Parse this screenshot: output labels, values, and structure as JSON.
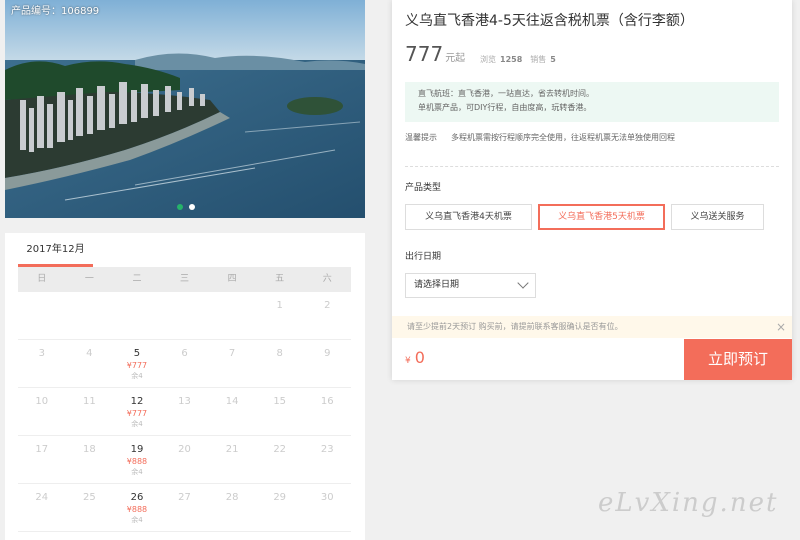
{
  "hero": {
    "product_id": "产品编号：106899",
    "carousel_count": 2,
    "carousel_active": 1
  },
  "calendar": {
    "month_label": "2017年12月",
    "weekdays": [
      "日",
      "一",
      "二",
      "三",
      "四",
      "五",
      "六"
    ],
    "weeks": [
      [
        {
          "day": "",
          "price": "",
          "stock": ""
        },
        {
          "day": "",
          "price": "",
          "stock": ""
        },
        {
          "day": "",
          "price": "",
          "stock": ""
        },
        {
          "day": "",
          "price": "",
          "stock": ""
        },
        {
          "day": "",
          "price": "",
          "stock": ""
        },
        {
          "day": "1",
          "price": "",
          "stock": ""
        },
        {
          "day": "2",
          "price": "",
          "stock": ""
        }
      ],
      [
        {
          "day": "3",
          "price": "",
          "stock": ""
        },
        {
          "day": "4",
          "price": "",
          "stock": ""
        },
        {
          "day": "5",
          "price": "¥777",
          "stock": "余4"
        },
        {
          "day": "6",
          "price": "",
          "stock": ""
        },
        {
          "day": "7",
          "price": "",
          "stock": ""
        },
        {
          "day": "8",
          "price": "",
          "stock": ""
        },
        {
          "day": "9",
          "price": "",
          "stock": ""
        }
      ],
      [
        {
          "day": "10",
          "price": "",
          "stock": ""
        },
        {
          "day": "11",
          "price": "",
          "stock": ""
        },
        {
          "day": "12",
          "price": "¥777",
          "stock": "余4"
        },
        {
          "day": "13",
          "price": "",
          "stock": ""
        },
        {
          "day": "14",
          "price": "",
          "stock": ""
        },
        {
          "day": "15",
          "price": "",
          "stock": ""
        },
        {
          "day": "16",
          "price": "",
          "stock": ""
        }
      ],
      [
        {
          "day": "17",
          "price": "",
          "stock": ""
        },
        {
          "day": "18",
          "price": "",
          "stock": ""
        },
        {
          "day": "19",
          "price": "¥888",
          "stock": "余4"
        },
        {
          "day": "20",
          "price": "",
          "stock": ""
        },
        {
          "day": "21",
          "price": "",
          "stock": ""
        },
        {
          "day": "22",
          "price": "",
          "stock": ""
        },
        {
          "day": "23",
          "price": "",
          "stock": ""
        }
      ],
      [
        {
          "day": "24",
          "price": "",
          "stock": ""
        },
        {
          "day": "25",
          "price": "",
          "stock": ""
        },
        {
          "day": "26",
          "price": "¥888",
          "stock": "余4"
        },
        {
          "day": "27",
          "price": "",
          "stock": ""
        },
        {
          "day": "28",
          "price": "",
          "stock": ""
        },
        {
          "day": "29",
          "price": "",
          "stock": ""
        },
        {
          "day": "30",
          "price": "",
          "stock": ""
        }
      ]
    ]
  },
  "product": {
    "title": "义乌直飞香港4-5天往返含税机票（含行李额）",
    "price": "777",
    "price_unit": "元起",
    "views_label": "浏览",
    "views": "1258",
    "sales_label": "销售",
    "sales": "5",
    "notice_line1": "直飞航班：直飞香港，一站直达，省去转机时间。",
    "notice_line2": "单机票产品，可DIY行程，自由度高，玩转香港。",
    "tips_label": "温馨提示",
    "tips_text": "多程机票需按行程顺序完全使用，往返程机票无法单独使用回程"
  },
  "options": {
    "type_label": "产品类型",
    "items": [
      "义乌直飞香港4天机票",
      "义乌直飞香港5天机票",
      "义乌送关服务"
    ],
    "selected": "义乌直飞香港5天机票",
    "date_label": "出行日期",
    "date_placeholder": "请选择日期"
  },
  "booking": {
    "warning": "请至少提前2天预订 购买前，请提前联系客服确认是否有位。",
    "close": "×",
    "currency": "¥",
    "total": "0",
    "book_label": "立即预订"
  },
  "watermark": "eLvXing.net",
  "colors": {
    "accent": "#f36d5a",
    "notice_bg": "#edf8f3",
    "warn_bg": "#fff8ea"
  }
}
